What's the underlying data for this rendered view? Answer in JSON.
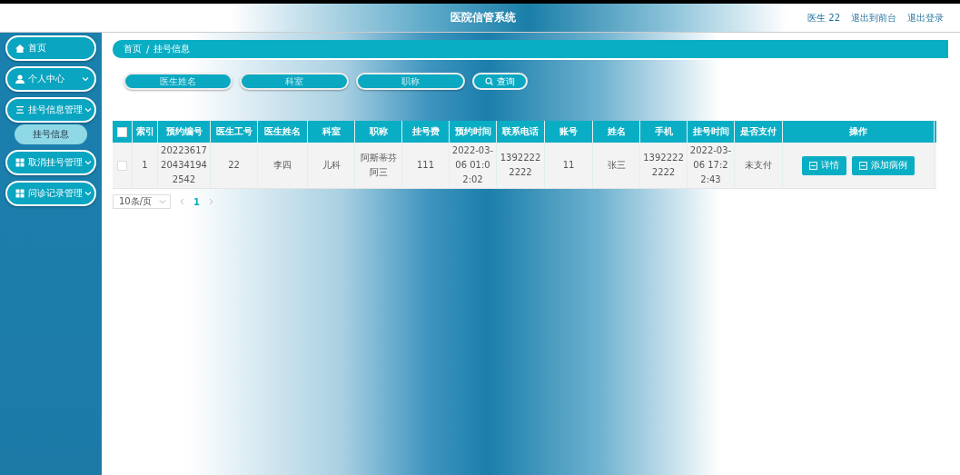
{
  "header": {
    "title": "医院信管系统",
    "links": [
      "医生 22",
      "退出到前台",
      "退出登录"
    ]
  },
  "sidebar": {
    "items": [
      {
        "label": "首页",
        "kind": "link"
      },
      {
        "label": "个人中心",
        "kind": "group"
      },
      {
        "label": "挂号信息管理",
        "kind": "group",
        "children": [
          {
            "label": "挂号信息",
            "selected": true
          }
        ]
      },
      {
        "label": "取消挂号管理",
        "kind": "group"
      },
      {
        "label": "问诊记录管理",
        "kind": "group"
      }
    ]
  },
  "breadcrumb": [
    "首页",
    "/",
    "挂号信息"
  ],
  "search": {
    "fields": [
      {
        "placeholder": "医生姓名"
      },
      {
        "placeholder": "科室"
      },
      {
        "placeholder": "职称"
      }
    ],
    "button": "查询"
  },
  "table": {
    "all_checked": false,
    "columns": [
      "索引",
      "预约编号",
      "医生工号",
      "医生姓名",
      "科室",
      "职称",
      "挂号费",
      "预约时间",
      "联系电话",
      "账号",
      "姓名",
      "手机",
      "挂号时间",
      "是否支付",
      "操作"
    ],
    "rows": [
      {
        "checked": false,
        "cells": [
          "1",
          "20223617204341942542",
          "22",
          "李四",
          "儿科",
          "阿斯蒂芬阿三",
          "111",
          "2022-03-06 01:02:02",
          "13922222222",
          "11",
          "张三",
          "13922222222",
          "2022-03-06 17:22:43",
          "未支付"
        ],
        "actions": [
          "详情",
          "添加病例"
        ]
      }
    ]
  },
  "pagination": {
    "page_size": "10条/页",
    "pages": [
      {
        "label": "1",
        "selected": true
      }
    ]
  }
}
